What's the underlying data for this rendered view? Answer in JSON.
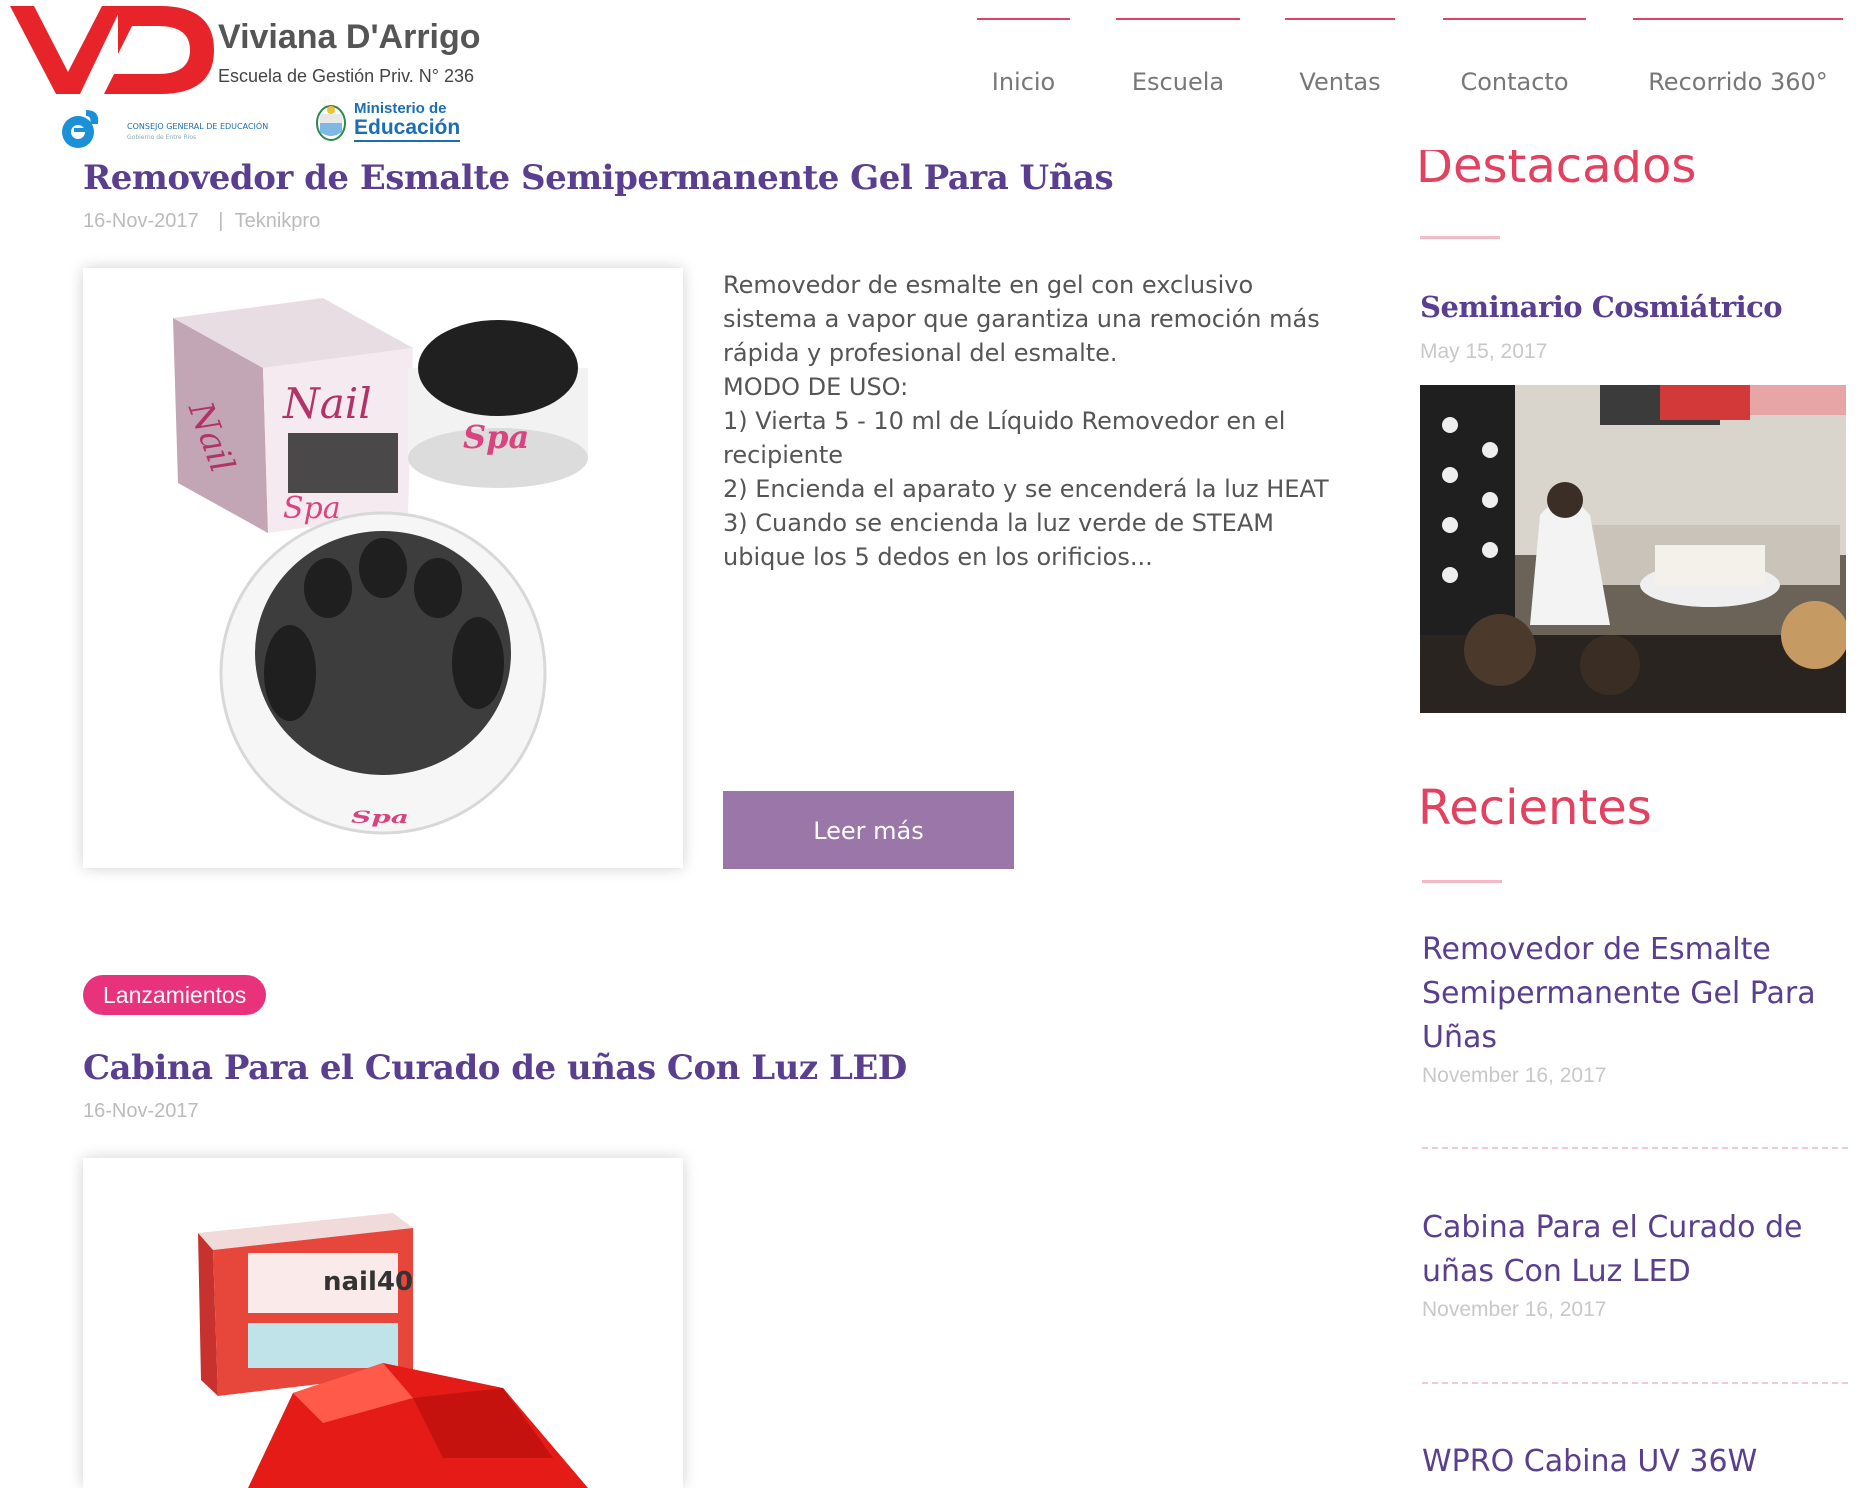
{
  "header": {
    "brand_mark": "VD",
    "brand_name": "Viviana D'Arrigo",
    "brand_subtitle": "Escuela de Gestión Priv. N° 236",
    "council_logo_text": "CONSEJO GENERAL DE EDUCACIÓN",
    "council_logo_subtext": "Gobierno de Entre Ríos",
    "ministry_line1": "Ministerio de",
    "ministry_line2": "Educación",
    "nav": [
      {
        "label": "Inicio"
      },
      {
        "label": "Escuela"
      },
      {
        "label": "Ventas"
      },
      {
        "label": "Contacto"
      },
      {
        "label": "Recorrido 360°"
      }
    ],
    "nav_accent": "#e24160"
  },
  "posts": [
    {
      "title": "Removedor de Esmalte Semipermanente Gel Para Uñas",
      "date": "16-Nov-2017",
      "separator": "|",
      "author": "Teknikpro",
      "image_icon": "gel-remover-product-image",
      "product_brand": "Spa",
      "product_box_label": "Nail",
      "excerpt_lines": [
        "Removedor de esmalte en gel con exclusivo sistema a vapor que garantiza una remoción más rápida y profesional del esmalte.",
        "MODO DE USO:",
        "1) Vierta 5 - 10 ml de Líquido Removedor en el recipiente",
        "2) Encienda el aparato y se encenderá la luz HEAT",
        "3) Cuando se encienda la luz verde de STEAM ubique los 5 dedos en los orificios..."
      ],
      "read_more": "Leer más"
    },
    {
      "category": "Lanzamientos",
      "title": "Cabina Para el Curado de uñas Con Luz LED",
      "date": "16-Nov-2017",
      "image_icon": "led-lamp-product-image",
      "product_box_label": "nail40"
    }
  ],
  "sidebar": {
    "featured_heading": "Destacados",
    "featured": {
      "title": "Seminario Cosmiátrico",
      "date": "May 15, 2017",
      "image_icon": "seminar-photo"
    },
    "recent_heading": "Recientes",
    "recent": [
      {
        "title": "Removedor de Esmalte Semipermanente Gel Para Uñas",
        "date": "November 16, 2017"
      },
      {
        "title": "Cabina Para el Curado de uñas Con Luz LED",
        "date": "November 16, 2017"
      },
      {
        "title": "WPRO Cabina UV 36W"
      }
    ]
  },
  "colors": {
    "title_purple": "#5a3e8f",
    "accent_red": "#e24160",
    "button_purple": "#9a76a9",
    "badge_pink": "#e8327b"
  }
}
